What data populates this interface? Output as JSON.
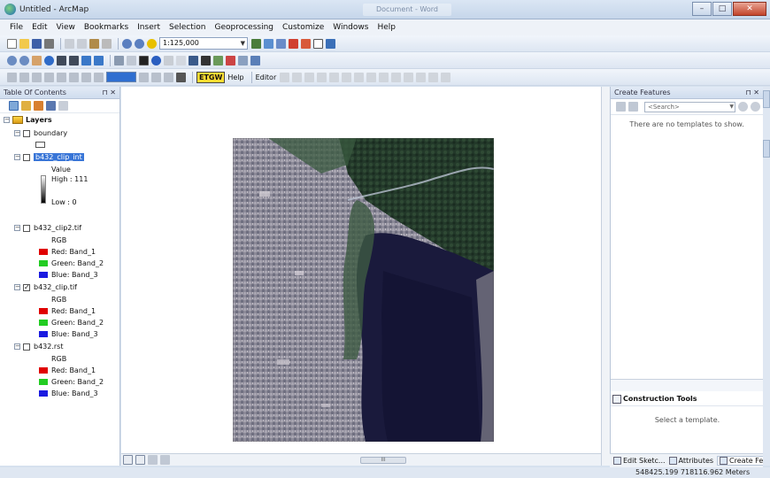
{
  "window": {
    "title": "Untitled - ArcMap",
    "center_title": "Document - Word"
  },
  "menu": [
    "File",
    "Edit",
    "View",
    "Bookmarks",
    "Insert",
    "Selection",
    "Geoprocessing",
    "Customize",
    "Windows",
    "Help"
  ],
  "toolbar": {
    "scale": "1:125,000",
    "help_label": "Help",
    "editor_label": "Editor",
    "etgw_label": "ETGW"
  },
  "toc": {
    "title": "Table Of Contents",
    "root": "Layers",
    "layers": [
      {
        "name": "boundary",
        "checked": false,
        "type": "polygon"
      },
      {
        "name": "b432_clip_int",
        "checked": false,
        "type": "stretch",
        "selected": true,
        "value_label": "Value",
        "high": "High : 111",
        "low": "Low : 0"
      },
      {
        "name": "b432_clip2.tif",
        "checked": false,
        "type": "rgb",
        "rgb_label": "RGB",
        "bands": [
          "Red:   Band_1",
          "Green: Band_2",
          "Blue:   Band_3"
        ]
      },
      {
        "name": "b432_clip.tif",
        "checked": true,
        "type": "rgb",
        "rgb_label": "RGB",
        "bands": [
          "Red:   Band_1",
          "Green: Band_2",
          "Blue:   Band_3"
        ]
      },
      {
        "name": "b432.rst",
        "checked": false,
        "type": "rgb",
        "rgb_label": "RGB",
        "bands": [
          "Red:   Band_1",
          "Green: Band_2",
          "Blue:   Band_3"
        ]
      }
    ],
    "band_colors": [
      "#e00000",
      "#22cc22",
      "#1a1ae0"
    ]
  },
  "create_features": {
    "title": "Create Features",
    "search_placeholder": "<Search>",
    "no_templates": "There are no templates to show."
  },
  "construction_tools": {
    "title": "Construction Tools",
    "message": "Select a template."
  },
  "bottom_tabs": [
    "Edit Sketc...",
    "Attributes",
    "Create Fea..."
  ],
  "status": {
    "coords": "548425.199  718116.962 Meters"
  }
}
